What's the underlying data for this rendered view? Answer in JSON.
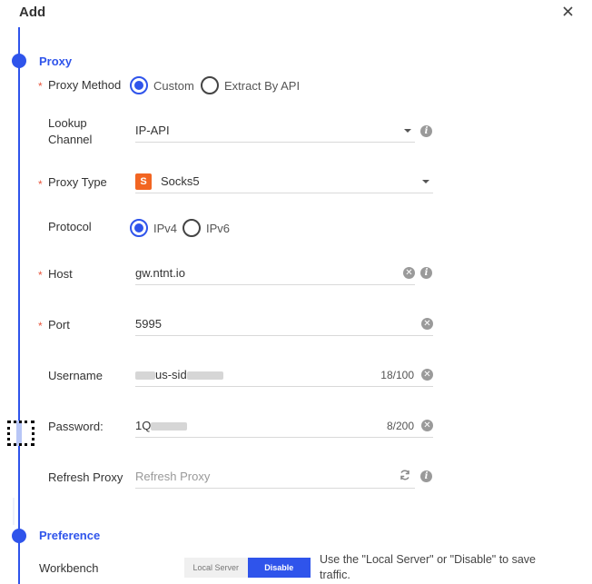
{
  "header": {
    "title": "Add",
    "close_icon": "close-icon"
  },
  "accent": "#2f54eb",
  "sections": {
    "proxy": {
      "title": "Proxy"
    },
    "preference": {
      "title": "Preference"
    }
  },
  "proxy_method": {
    "label": "Proxy Method",
    "options": [
      "Custom",
      "Extract By API"
    ],
    "selected": "Custom"
  },
  "lookup_channel": {
    "label_line1": "Lookup",
    "label_line2": "Channel",
    "value": "IP-API"
  },
  "proxy_type": {
    "label": "Proxy Type",
    "value": "Socks5",
    "badge": "S",
    "badge_color": "#f26522"
  },
  "protocol": {
    "label": "Protocol",
    "options": [
      "IPv4",
      "IPv6"
    ],
    "selected": "IPv4"
  },
  "host": {
    "label": "Host",
    "value": "gw.ntnt.io"
  },
  "port": {
    "label": "Port",
    "value": "5995"
  },
  "username": {
    "label": "Username",
    "value_visible": "us-sid",
    "counter": "18/100"
  },
  "password": {
    "label": "Password:",
    "value_visible": "1Q",
    "counter": "8/200"
  },
  "refresh_proxy": {
    "label": "Refresh Proxy",
    "placeholder": "Refresh Proxy"
  },
  "workbench": {
    "label": "Workbench",
    "options": [
      "Local Server",
      "Disable"
    ],
    "selected": "Disable",
    "description": "Use the \"Local Server\" or \"Disable\" to save traffic."
  }
}
